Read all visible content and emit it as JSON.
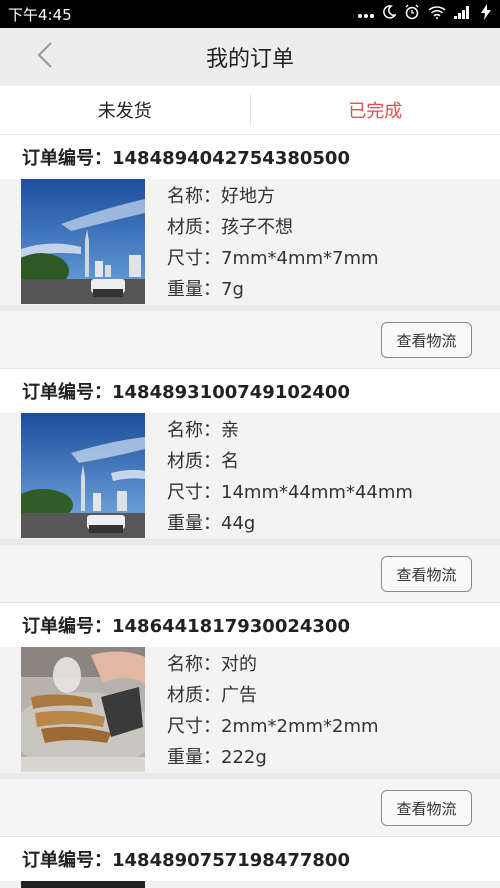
{
  "status_bar": {
    "time": "下午4:45",
    "icons": [
      "more-dots-icon",
      "moon-icon",
      "alarm-icon",
      "wifi-icon",
      "signal-icon",
      "battery-charging-icon"
    ]
  },
  "navbar": {
    "back_icon": "chevron-left-icon",
    "title": "我的订单"
  },
  "tabs": [
    {
      "label": "未发货",
      "active": false
    },
    {
      "label": "已完成",
      "active": true
    }
  ],
  "colors": {
    "accent": "#e84c4c"
  },
  "orders": [
    {
      "number_label": "订单编号：1484894042754380500",
      "image": "city-skyline-photo",
      "name": "名称：好地方",
      "material": "材质：孩子不想",
      "size": "尺寸：7mm*4mm*7mm",
      "weight": "重量：7g",
      "button": "查看物流"
    },
    {
      "number_label": "订单编号：1484893100749102400",
      "image": "city-skyline-photo",
      "name": "名称：亲",
      "material": "材质：名",
      "size": "尺寸：14mm*44mm*44mm",
      "weight": "重量：44g",
      "button": "查看物流"
    },
    {
      "number_label": "订单编号：1486441817930024300",
      "image": "grill-food-photo",
      "name": "名称：对的",
      "material": "材质：广告",
      "size": "尺寸：2mm*2mm*2mm",
      "weight": "重量：222g",
      "button": "查看物流"
    },
    {
      "number_label": "订单编号：1484890757198477800"
    }
  ]
}
